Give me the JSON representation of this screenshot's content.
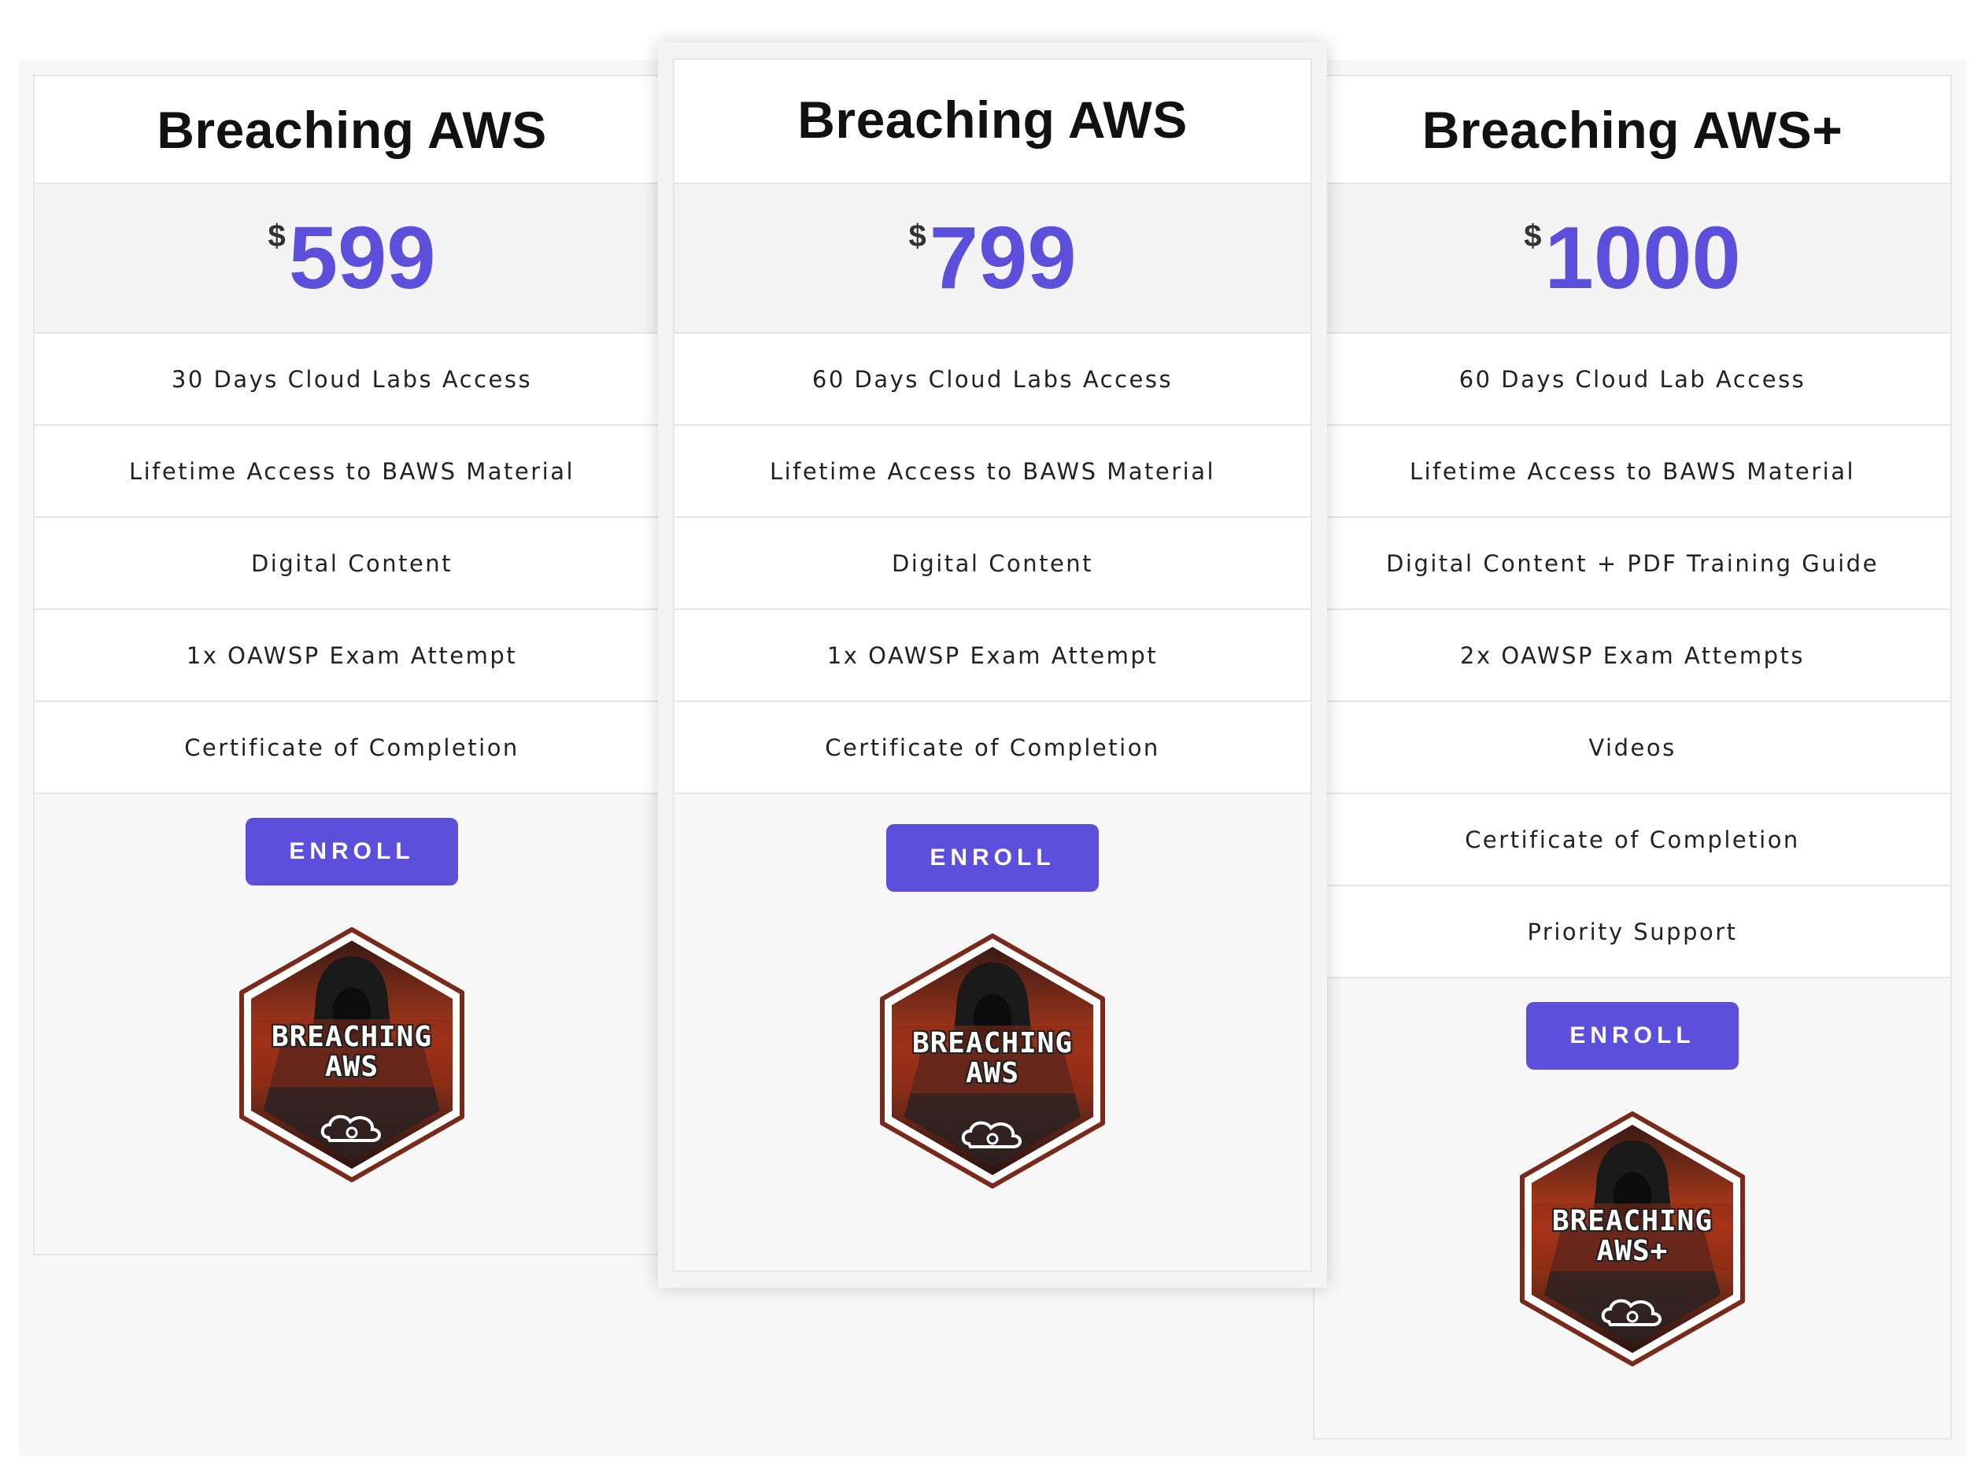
{
  "plans": [
    {
      "title": "Breaching AWS",
      "currency": "$",
      "price": "599",
      "features": [
        "30 Days Cloud Labs Access",
        "Lifetime Access to BAWS Material",
        "Digital Content",
        "1x OAWSP Exam Attempt",
        "Certificate of Completion"
      ],
      "button": "ENROLL",
      "badge": {
        "line1": "BREACHING",
        "line2": "AWS",
        "icon": "cloud-bug-icon"
      }
    },
    {
      "title": "Breaching AWS",
      "currency": "$",
      "price": "799",
      "features": [
        "60 Days Cloud Labs Access",
        "Lifetime Access to BAWS Material",
        "Digital Content",
        "1x OAWSP Exam Attempt",
        "Certificate of Completion"
      ],
      "button": "ENROLL",
      "badge": {
        "line1": "BREACHING",
        "line2": "AWS",
        "icon": "cloud-bug-icon"
      }
    },
    {
      "title": "Breaching AWS+",
      "currency": "$",
      "price": "1000",
      "features": [
        "60 Days Cloud Lab Access",
        "Lifetime Access to BAWS Material",
        "Digital Content + PDF Training Guide",
        "2x OAWSP Exam Attempts",
        "Videos",
        "Certificate of Completion",
        "Priority Support"
      ],
      "button": "ENROLL",
      "badge": {
        "line1": "BREACHING",
        "line2": "AWS+",
        "icon": "cloud-bug-icon"
      }
    }
  ],
  "colors": {
    "accent": "#5b4fdb",
    "badge_border": "#7a2a1a",
    "badge_fill": "#a8361c"
  }
}
